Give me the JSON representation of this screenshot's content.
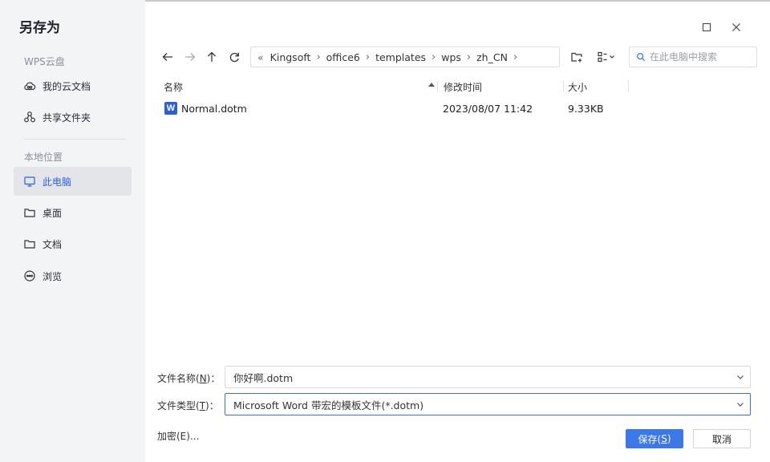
{
  "dialog": {
    "title": "另存为"
  },
  "sidebar": {
    "cloud_section": "WPS云盘",
    "cloud_items": [
      {
        "label": "我的云文档",
        "icon": "cloud-icon"
      },
      {
        "label": "共享文件夹",
        "icon": "share-folder-icon"
      }
    ],
    "local_section": "本地位置",
    "local_items": [
      {
        "label": "此电脑",
        "icon": "computer-icon",
        "active": true
      },
      {
        "label": "桌面",
        "icon": "folder-icon"
      },
      {
        "label": "文档",
        "icon": "folder-icon"
      },
      {
        "label": "浏览",
        "icon": "browse-icon"
      }
    ]
  },
  "breadcrumb": {
    "items": [
      "Kingsoft",
      "office6",
      "templates",
      "wps",
      "zh_CN"
    ]
  },
  "search": {
    "placeholder": "在此电脑中搜索"
  },
  "columns": {
    "name": "名称",
    "modified": "修改时间",
    "size": "大小"
  },
  "files": [
    {
      "name": "Normal.dotm",
      "modified": "2023/08/07 11:42",
      "size": "9.33KB",
      "icon_letter": "W"
    }
  ],
  "form": {
    "filename_label": "文件名称(",
    "filename_key": "N",
    "filename_suffix": ")：",
    "filename_value": "你好啊.dotm",
    "filetype_label": "文件类型(",
    "filetype_key": "T",
    "filetype_suffix": ")：",
    "filetype_value": "Microsoft Word 带宏的模板文件(*.dotm)",
    "encrypt_label": "加密(E)..."
  },
  "buttons": {
    "save_prefix": "保存(",
    "save_key": "S",
    "save_suffix": ")",
    "cancel": "取消"
  },
  "colors": {
    "accent": "#3c78e8",
    "sidebar_bg": "#f3f4f6",
    "word_icon": "#2b5fd9"
  }
}
